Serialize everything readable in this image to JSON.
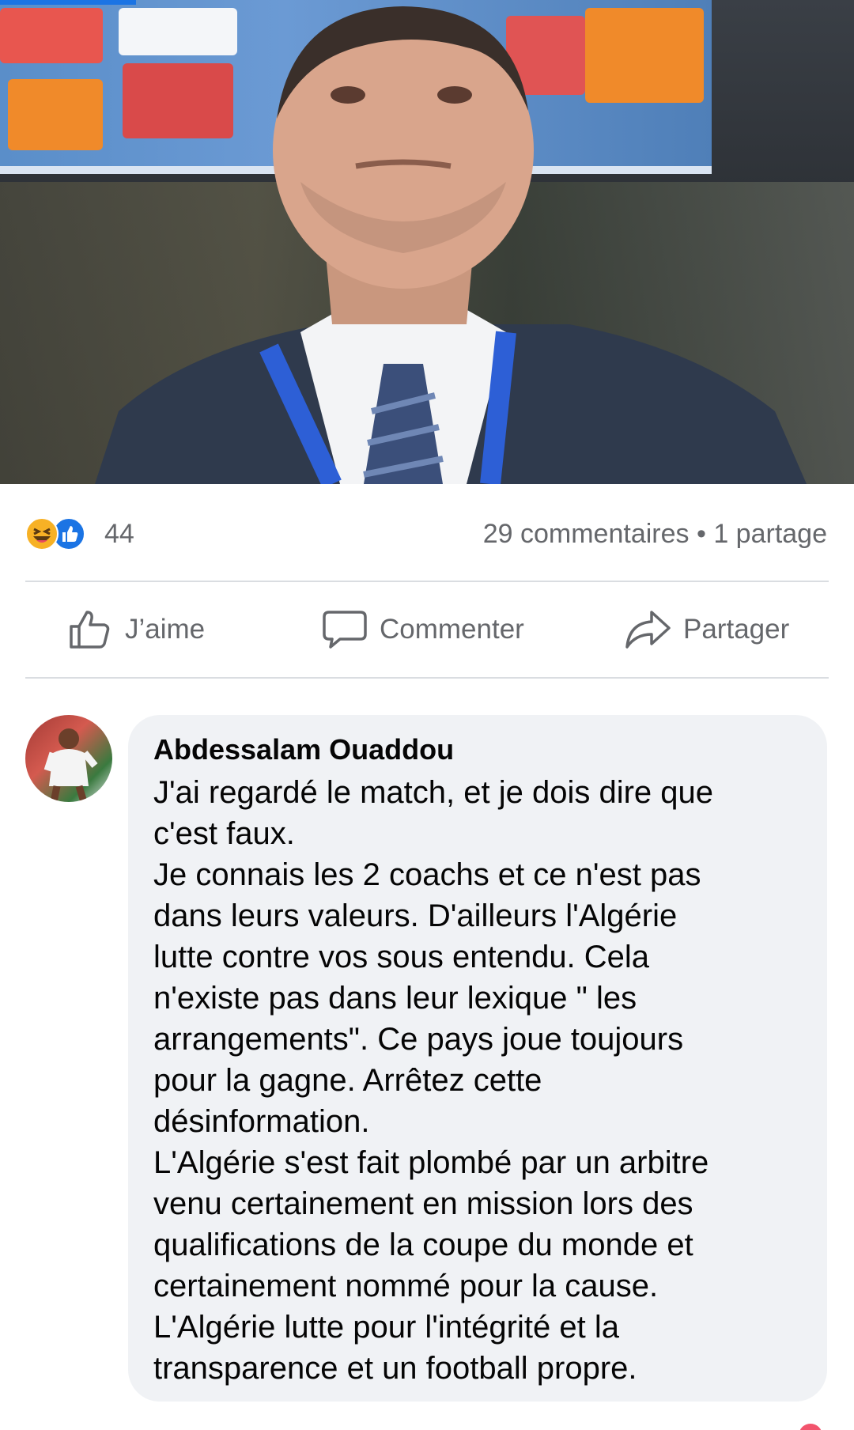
{
  "post": {
    "photo_icon": "coach-photo"
  },
  "reactions": {
    "icons": [
      "haha-reaction-icon",
      "like-reaction-icon"
    ],
    "count": "44",
    "comments": "29 commentaires",
    "separator": "•",
    "shares": "1 partage"
  },
  "actions": {
    "like_label": "J’aime",
    "comment_label": "Commenter",
    "share_label": "Partager"
  },
  "comment": {
    "author": "Abdessalam Ouaddou",
    "lines": [
      "J'ai regardé le match,  et je dois dire que",
      "c'est faux.",
      "Je connais les 2 coachs et ce n'est pas",
      "dans leurs valeurs.  D'ailleurs l'Algérie",
      "lutte contre vos sous entendu.  Cela",
      "n'existe pas dans leur lexique \" les",
      "arrangements\".  Ce pays joue toujours",
      "pour la gagne.  Arrêtez cette",
      "désinformation.",
      "L'Algérie s'est fait plombé par un arbitre",
      "venu certainement en mission lors des",
      "qualifications de la coupe du monde et",
      "certainement nommé pour la cause.",
      "L'Algérie lutte pour l'intégrité et la",
      "transparence et un football propre."
    ]
  },
  "colors": {
    "accent": "#1b74e4",
    "muted_text": "#65676b",
    "bubble": "#f0f2f5",
    "haha": "#f7b125"
  }
}
